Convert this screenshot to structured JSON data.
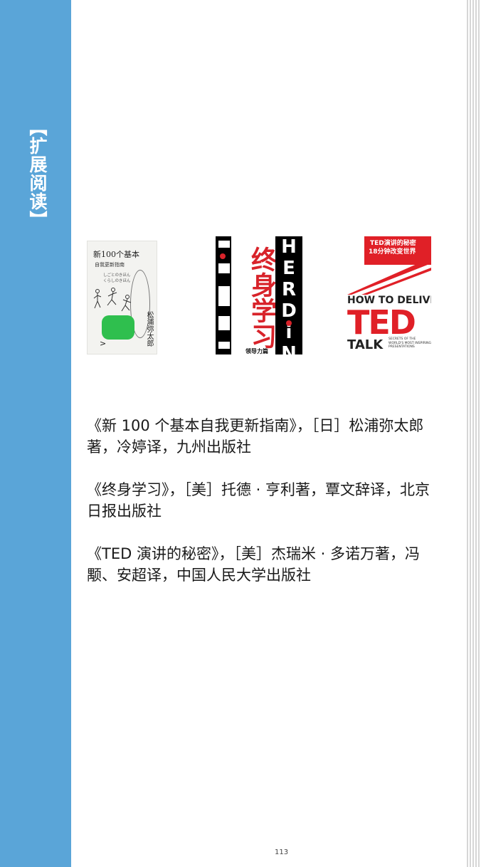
{
  "sidebar": {
    "title": "【扩展阅读】",
    "color": "#5aa5d8"
  },
  "covers": [
    {
      "title_line": "新100个基本",
      "subtitle": "自我更新指南",
      "jp_lines": [
        "しごとのきほん",
        "くらしのきほん"
      ],
      "author": "松浦弥太郎",
      "accent_color": "#2fbf4e"
    },
    {
      "title": "终身学习",
      "tagline": "领导力篇",
      "side_text": "HERDiN",
      "accent_color": "#d8232a"
    },
    {
      "top_line_1": "TED演讲的秘密",
      "top_line_2": "18分钟改变世界",
      "line_how": "HOW TO DELIVER",
      "line_ted": "TED",
      "line_talk": "TALK",
      "small_text": "SECRETS OF THE WORLD'S MOST INSPIRING PRESENTATIONS",
      "accent_color": "#e02027"
    }
  ],
  "books": [
    "《新 100 个基本自我更新指南》，［日］松浦弥太郎著，冷婷译，九州出版社",
    "《终身学习》，［美］托德 · 亨利著，覃文辞译，北京日报出版社",
    "《TED 演讲的秘密》，［美］杰瑞米 · 多诺万著，冯颙、安超译，中国人民大学出版社"
  ],
  "page_number": "113"
}
